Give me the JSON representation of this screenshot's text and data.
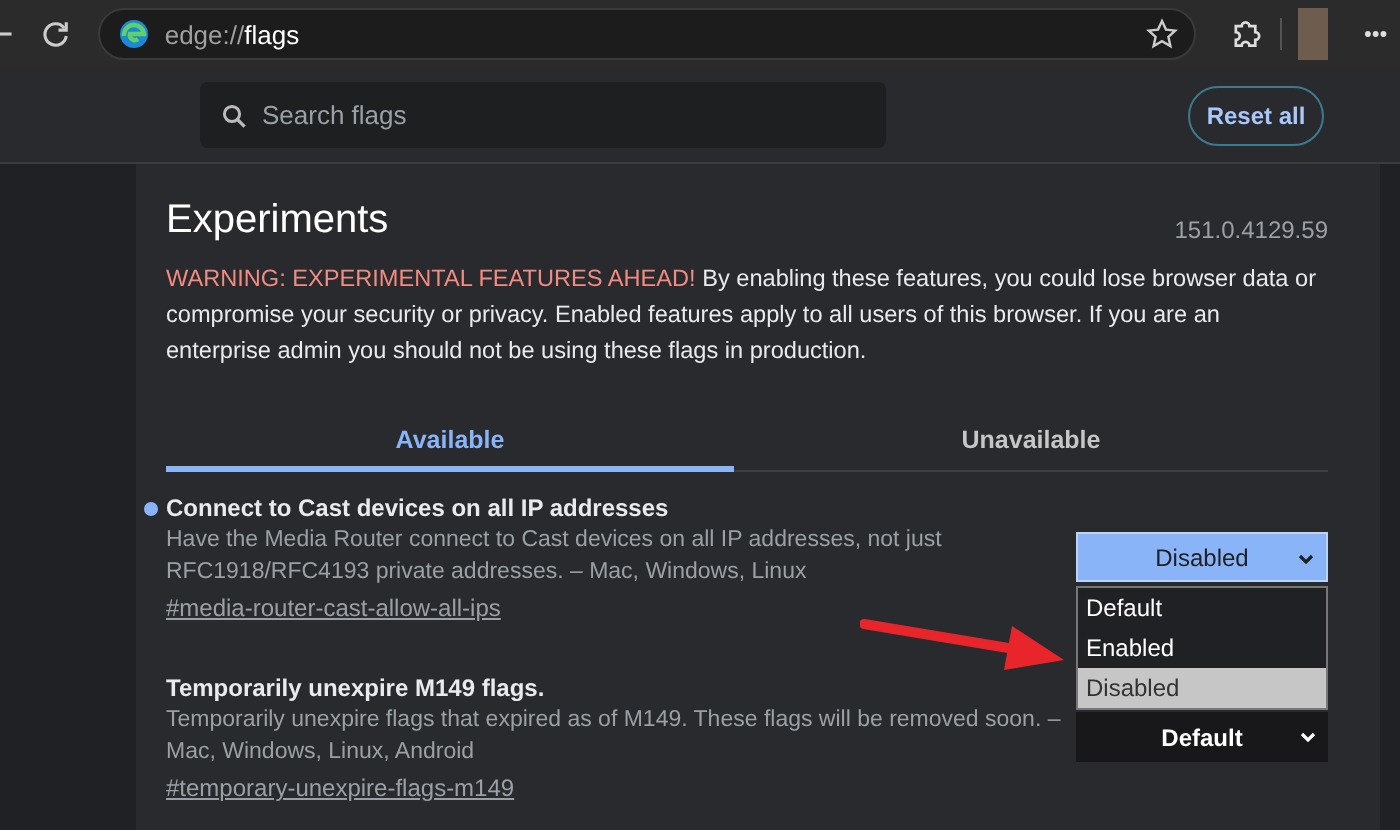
{
  "browser": {
    "address": {
      "scheme": "edge://",
      "path": "flags"
    }
  },
  "search": {
    "placeholder": "Search flags"
  },
  "reset_button": "Reset all",
  "header": {
    "title": "Experiments",
    "version": "151.0.4129.59",
    "warning_lead": "WARNING: EXPERIMENTAL FEATURES AHEAD!",
    "warning_body": " By enabling these features, you could lose browser data or compromise your security or privacy. Enabled features apply to all users of this browser. If you are an enterprise admin you should not be using these flags in production."
  },
  "tabs": [
    {
      "label": "Available",
      "selected": true
    },
    {
      "label": "Unavailable",
      "selected": false
    }
  ],
  "flags": [
    {
      "title": "Connect to Cast devices on all IP addresses",
      "modified": true,
      "description": "Have the Media Router connect to Cast devices on all IP addresses, not just RFC1918/RFC4193 private addresses. – Mac, Windows, Linux",
      "link": "#media-router-cast-allow-all-ips",
      "select": {
        "value": "Disabled",
        "open": true,
        "options": [
          {
            "label": "Default",
            "selected": false
          },
          {
            "label": "Enabled",
            "selected": false
          },
          {
            "label": "Disabled",
            "selected": true
          }
        ]
      }
    },
    {
      "title": "Temporarily unexpire M149 flags.",
      "modified": false,
      "description": "Temporarily unexpire flags that expired as of M149. These flags will be removed soon. – Mac, Windows, Linux, Android",
      "link": "#temporary-unexpire-flags-m149",
      "select": {
        "value": "Default",
        "open": false
      }
    }
  ]
}
